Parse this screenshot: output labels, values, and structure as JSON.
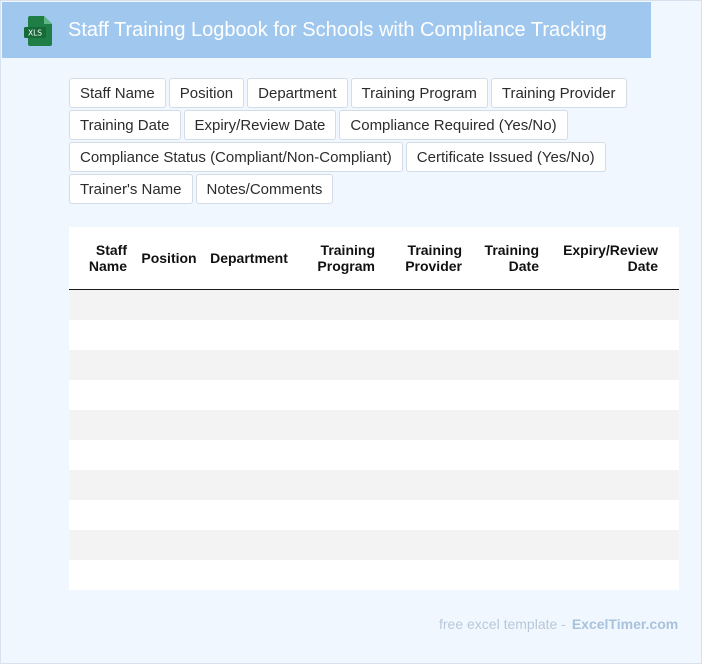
{
  "header": {
    "title": "Staff Training Logbook for Schools with Compliance Tracking",
    "icon": "xls-file-icon",
    "icon_text": "XLS",
    "icon_color": "#1e7e45"
  },
  "fields": [
    "Staff Name",
    "Position",
    "Department",
    "Training Program",
    "Training Provider",
    "Training Date",
    "Expiry/Review Date",
    "Compliance Required (Yes/No)",
    "Compliance Status (Compliant/Non-Compliant)",
    "Certificate Issued (Yes/No)",
    "Trainer's Name",
    "Notes/Comments"
  ],
  "table": {
    "columns": [
      {
        "line1": "Staff",
        "line2": "Name"
      },
      {
        "line1": "Position",
        "line2": ""
      },
      {
        "line1": "Department",
        "line2": ""
      },
      {
        "line1": "Training",
        "line2": "Program"
      },
      {
        "line1": "Training",
        "line2": "Provider"
      },
      {
        "line1": "Training",
        "line2": "Date"
      },
      {
        "line1": "Expiry/Review",
        "line2": "Date"
      }
    ],
    "rows": [
      [
        "",
        "",
        "",
        "",
        "",
        "",
        ""
      ],
      [
        "",
        "",
        "",
        "",
        "",
        "",
        ""
      ],
      [
        "",
        "",
        "",
        "",
        "",
        "",
        ""
      ],
      [
        "",
        "",
        "",
        "",
        "",
        "",
        ""
      ],
      [
        "",
        "",
        "",
        "",
        "",
        "",
        ""
      ],
      [
        "",
        "",
        "",
        "",
        "",
        "",
        ""
      ],
      [
        "",
        "",
        "",
        "",
        "",
        "",
        ""
      ],
      [
        "",
        "",
        "",
        "",
        "",
        "",
        ""
      ],
      [
        "",
        "",
        "",
        "",
        "",
        "",
        ""
      ],
      [
        "",
        "",
        "",
        "",
        "",
        "",
        ""
      ]
    ],
    "stripe_color": "#f3f3f3"
  },
  "footer": {
    "text": "free excel template -",
    "brand": "ExcelTimer.com"
  },
  "colors": {
    "header_bg": "#a0c8ef",
    "page_bg": "#f1f7fe"
  }
}
